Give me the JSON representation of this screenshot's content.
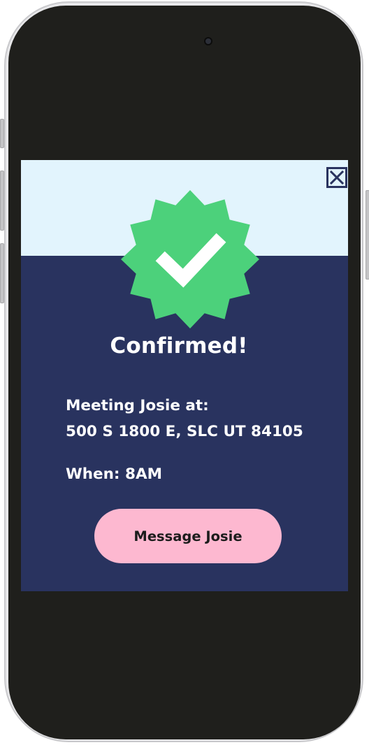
{
  "modal": {
    "title": "Confirmed!",
    "meeting_line": "Meeting Josie at:",
    "address_line": "500 S 1800 E, SLC UT 84105",
    "when_line": "When: 8AM",
    "message_button_label": "Message Josie",
    "close_icon": "close-icon",
    "badge_icon": "verified-check-badge-icon"
  },
  "colors": {
    "modal_bg": "#29335f",
    "modal_header_bg": "#e2f4fd",
    "badge_green": "#4cd17b",
    "button_pink": "#fdb8d0",
    "screen_bg": "#1f1f1c"
  }
}
